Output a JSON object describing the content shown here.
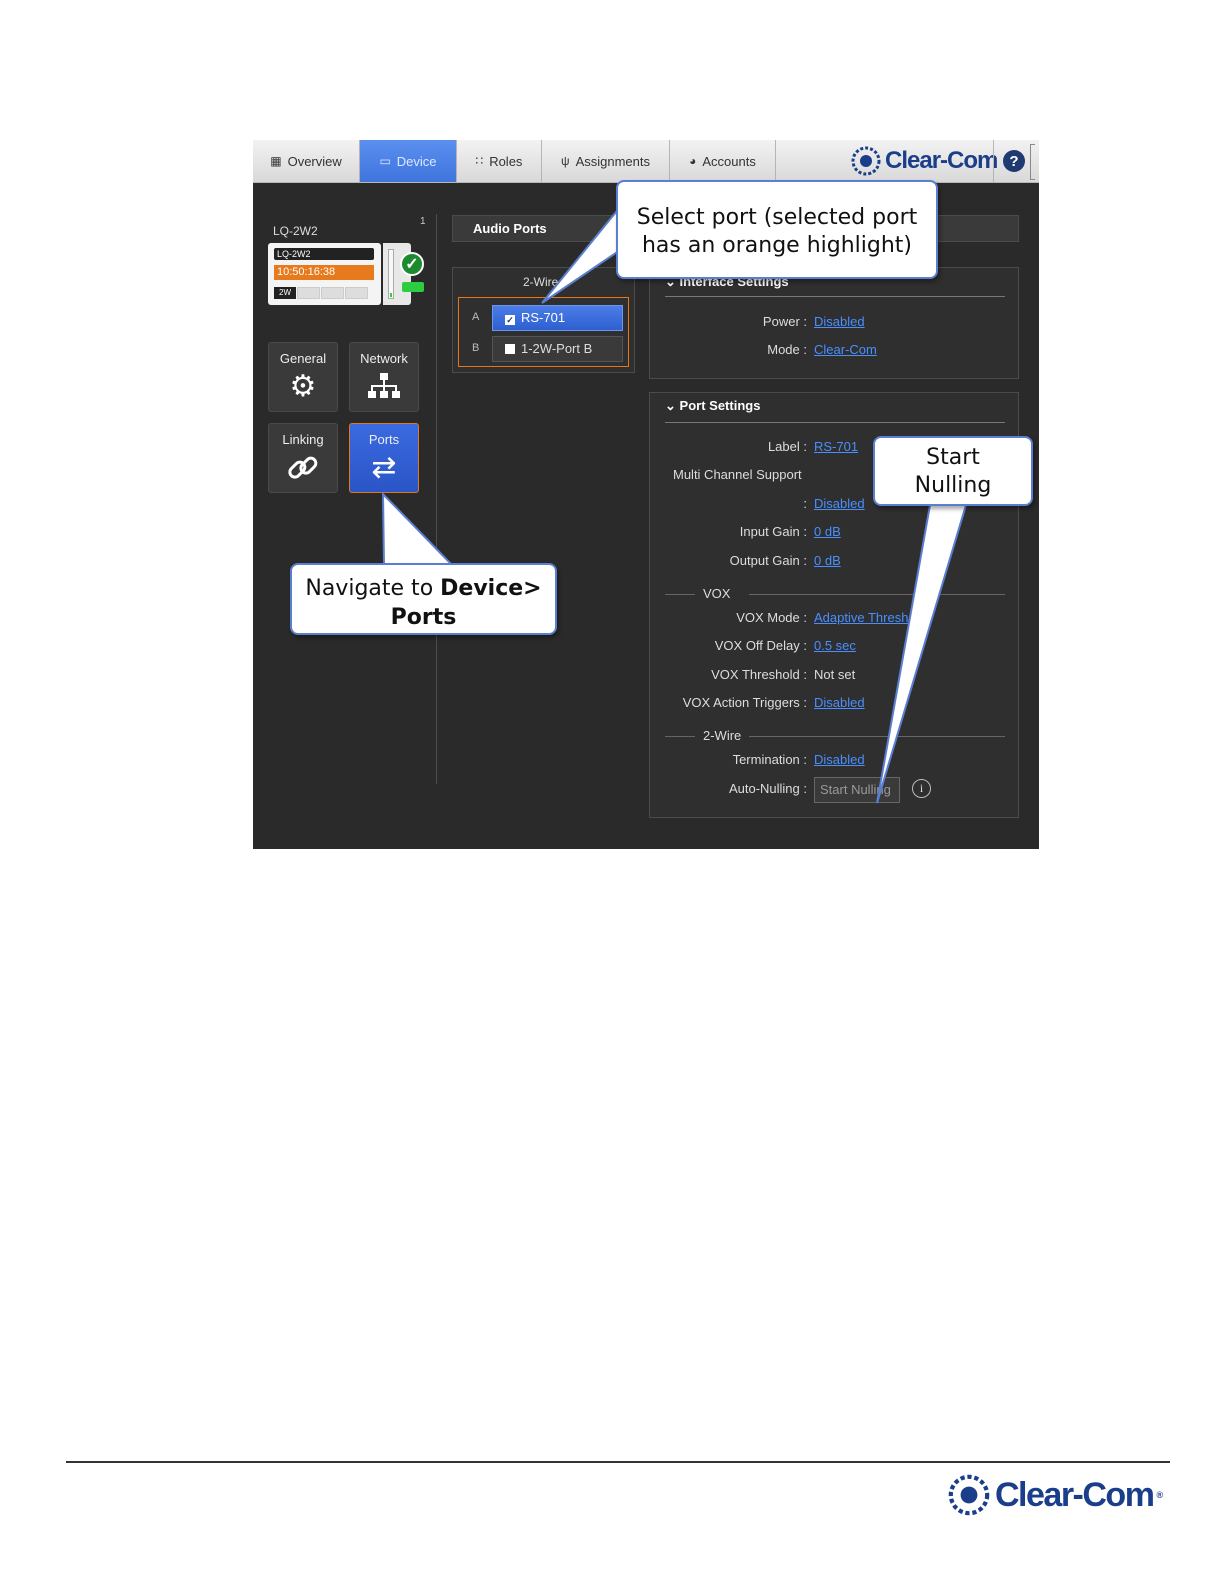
{
  "tabs": [
    {
      "label": "Overview",
      "icon": "grid-icon"
    },
    {
      "label": "Device",
      "icon": "device-icon"
    },
    {
      "label": "Roles",
      "icon": "people-icon"
    },
    {
      "label": "Assignments",
      "icon": "antenna-icon"
    },
    {
      "label": "Accounts",
      "icon": "globe-icon"
    }
  ],
  "brand": {
    "name": "Clear-Com",
    "help": "?"
  },
  "device": {
    "name": "LQ-2W2",
    "number": "1",
    "card_label": "LQ-2W2",
    "time": "10:50:16:38",
    "type": "2W"
  },
  "tiles": {
    "general": "General",
    "network": "Network",
    "linking": "Linking",
    "ports": "Ports"
  },
  "audio_ports": {
    "title": "Audio Ports",
    "group": "2-Wire",
    "ports": [
      {
        "key": "A",
        "label": "RS-701",
        "checked": true
      },
      {
        "key": "B",
        "label": "1-2W-Port B",
        "checked": false
      }
    ]
  },
  "interface_settings": {
    "title": "Interface Settings",
    "power_label": "Power :",
    "power_value": "Disabled",
    "mode_label": "Mode :",
    "mode_value": "Clear-Com"
  },
  "port_settings": {
    "title": "Port Settings",
    "label_k": "Label :",
    "label_v": "RS-701",
    "multi_k": "Multi Channel Support",
    "multi_colon": ":",
    "multi_v": "Disabled",
    "input_gain_k": "Input Gain :",
    "input_gain_v": "0 dB",
    "output_gain_k": "Output Gain :",
    "output_gain_v": "0 dB",
    "vox_section": "VOX",
    "vox_mode_k": "VOX Mode :",
    "vox_mode_v": "Adaptive Thresh",
    "vox_off_delay_k": "VOX Off Delay :",
    "vox_off_delay_v": "0.5 sec",
    "vox_threshold_k": "VOX Threshold :",
    "vox_threshold_v": "Not set",
    "vox_triggers_k": "VOX Action Triggers :",
    "vox_triggers_v": "Disabled",
    "twowire_section": "2-Wire",
    "termination_k": "Termination :",
    "termination_v": "Disabled",
    "auto_nulling_k": "Auto-Nulling :",
    "auto_nulling_btn": "Start Nulling",
    "info": "i"
  },
  "callouts": {
    "select_line1": "Select port (selected port",
    "select_line2": "has an orange highlight)",
    "nav_prefix": "Navigate to ",
    "nav_bold1": "Device>",
    "nav_bold2": "Ports",
    "null_line1": "Start",
    "null_line2": "Nulling"
  },
  "footer": {
    "brand": "Clear-Com",
    "trademark": "®"
  },
  "colors": {
    "active_tab": "#3f74dd",
    "link": "#4a8fff",
    "selection": "#e07820",
    "brand": "#1a3e8a"
  }
}
